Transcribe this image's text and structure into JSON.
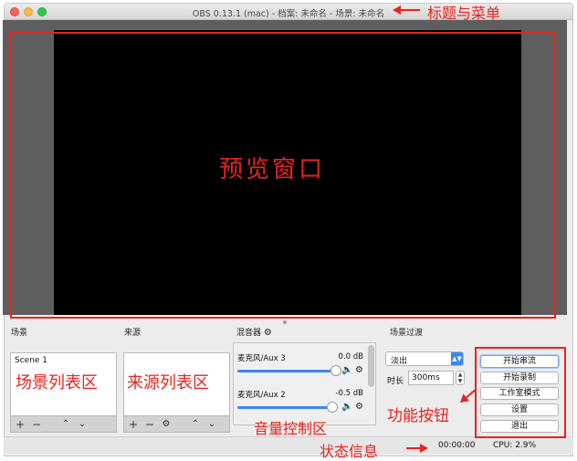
{
  "window": {
    "title": "OBS 0.13.1 (mac) - 档案: 未命名 - 场景: 未命名"
  },
  "docks": {
    "scenes": {
      "title": "场景",
      "items": [
        "Scene 1"
      ]
    },
    "sources": {
      "title": "来源"
    },
    "mixer": {
      "title": "混音器",
      "channels": [
        {
          "name": "麦克风/Aux 3",
          "db": "0.0 dB",
          "level": 1.0
        },
        {
          "name": "麦克风/Aux 2",
          "db": "-0.5 dB",
          "level": 0.96
        }
      ]
    },
    "transitions": {
      "title": "场景过渡",
      "selected": "淡出",
      "duration_label": "时长",
      "duration_value": "300ms"
    }
  },
  "controls": {
    "start_streaming": "开始串流",
    "start_recording": "开始录制",
    "studio_mode": "工作室模式",
    "settings": "设置",
    "exit": "退出"
  },
  "status": {
    "time": "00:00:00",
    "cpu": "CPU: 2.9%"
  },
  "annotations": {
    "title_menu": "标题与菜单",
    "preview": "预览窗口",
    "scene_list": "场景列表区",
    "source_list": "来源列表区",
    "volume": "音量控制区",
    "function_buttons": "功能按钮",
    "status": "状态信息"
  },
  "colors": {
    "annotation": "#e8231f",
    "accent": "#3b86f5"
  }
}
